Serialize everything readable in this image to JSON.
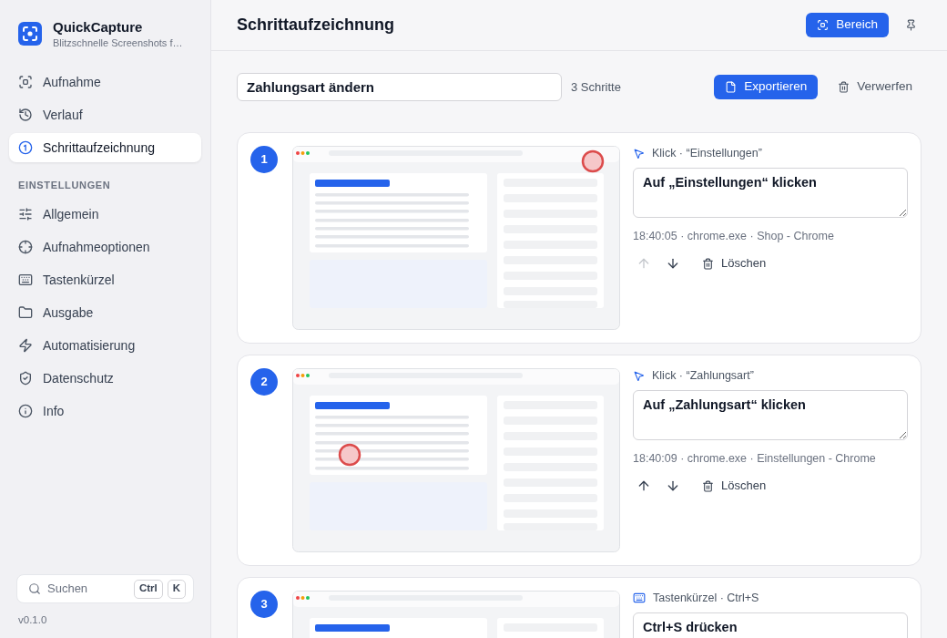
{
  "sidebar": {
    "app_name": "QuickCapture",
    "tagline": "Blitzschnelle Screenshots f…",
    "nav": [
      {
        "label": "Aufnahme",
        "selected": false
      },
      {
        "label": "Verlauf",
        "selected": false
      },
      {
        "label": "Schrittaufzeichnung",
        "selected": true
      }
    ],
    "section_title": "EINSTELLUNGEN",
    "settings": [
      {
        "label": "Allgemein",
        "selected": false
      },
      {
        "label": "Aufnahmeoptionen",
        "selected": false
      },
      {
        "label": "Tastenkürzel",
        "selected": false
      },
      {
        "label": "Ausgabe",
        "selected": false
      },
      {
        "label": "Automatisierung",
        "selected": false
      },
      {
        "label": "Datenschutz",
        "selected": false
      },
      {
        "label": "Info",
        "selected": false
      }
    ],
    "search": {
      "placeholder": "Suchen",
      "shortcut": [
        "Ctrl",
        "K"
      ]
    },
    "version": "v0.1.0"
  },
  "header": {
    "title": "Schrittaufzeichnung",
    "region_button": "Bereich"
  },
  "recording": {
    "name": "Zahlungsart ändern",
    "step_count": "3 Schritte",
    "export_button": "Exportieren",
    "discard_button": "Verwerfen"
  },
  "steps": [
    {
      "number": "1",
      "kind": "click",
      "action": "Klick · “Einstellungen”",
      "description": "Auf „Einstellungen“ klicken",
      "click_marker": true,
      "meta": "18:40:05 · chrome.exe · Shop - Chrome",
      "up_disabled": true,
      "delete_button": "Löschen"
    },
    {
      "number": "2",
      "kind": "click",
      "action": "Klick · “Zahlungsart”",
      "description": "Auf „Zahlungsart“ klicken",
      "click_marker": true,
      "meta": "18:40:09 · chrome.exe · Einstellungen - Chrome",
      "up_disabled": false,
      "delete_button": "Löschen"
    },
    {
      "number": "3",
      "kind": "shortcut",
      "action": "Tastenkürzel · Ctrl+S",
      "description": "Ctrl+S drücken"
    }
  ]
}
